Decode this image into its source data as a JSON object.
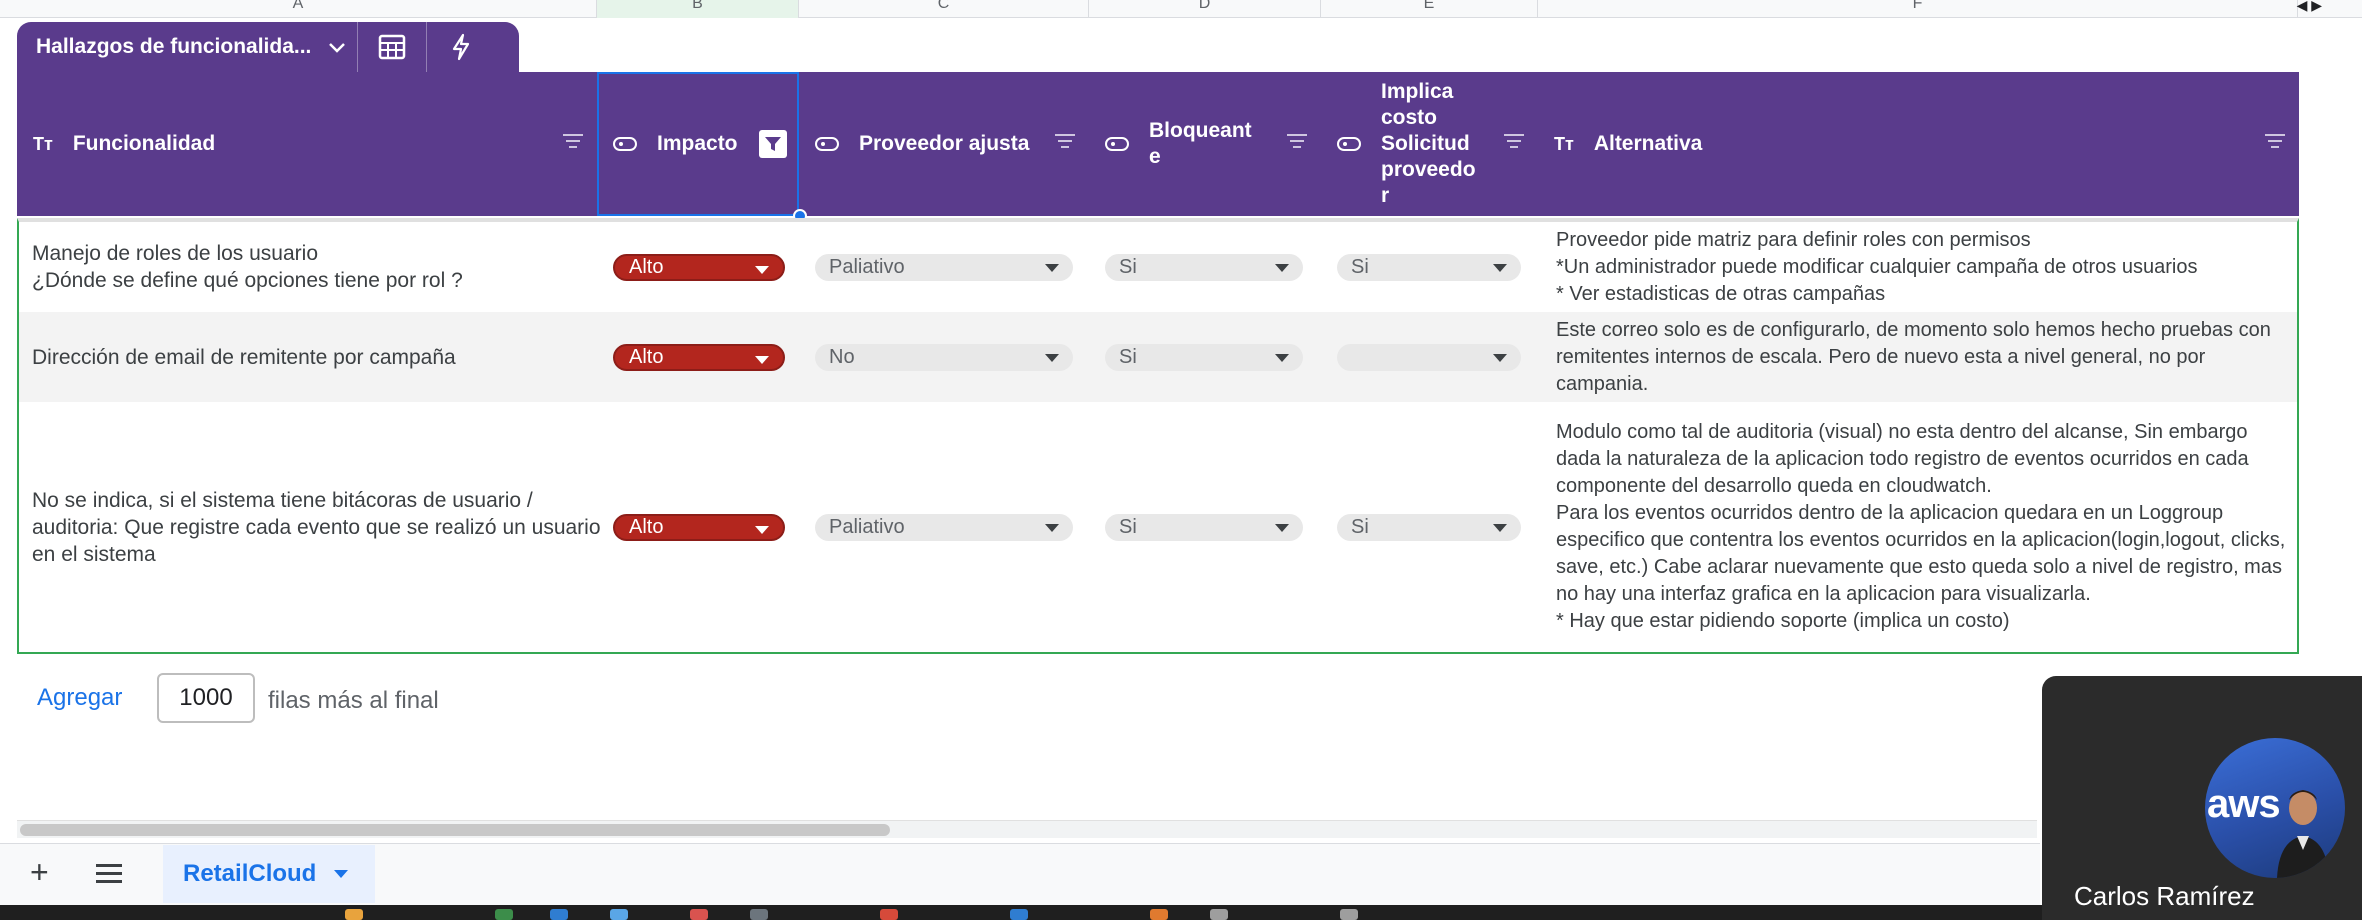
{
  "column_letters": [
    "A",
    "B",
    "C",
    "D",
    "E",
    "F"
  ],
  "table_tab": {
    "name": "Hallazgos de funcionalida..."
  },
  "headers": {
    "funcionalidad": "Funcionalidad",
    "impacto": "Impacto",
    "proveedor": "Proveedor ajusta",
    "bloqueante": "Bloqueant e",
    "implica": "Implica costo Solicitud proveedo r",
    "alternativa": "Alternativa",
    "text_icon": "Tт"
  },
  "rows": [
    {
      "funcionalidad": "Manejo de roles de los usuario\n¿Dónde se define qué opciones tiene por rol ?",
      "impacto": "Alto",
      "proveedor": "Paliativo",
      "bloqueante": "Si",
      "implica": "Si",
      "alternativa": "Proveedor pide matriz para definir roles con permisos\n*Un administrador puede modificar cualquier campaña de otros usuarios\n* Ver estadisticas de otras campañas"
    },
    {
      "funcionalidad": "Dirección de email de remitente por campaña",
      "impacto": "Alto",
      "proveedor": "No",
      "bloqueante": "Si",
      "implica": "",
      "alternativa": "Este correo solo es de configurarlo, de momento solo hemos hecho pruebas con remitentes internos de escala. Pero de nuevo esta a nivel general, no por campania."
    },
    {
      "funcionalidad": "No se indica, si el sistema tiene bitácoras de usuario / auditoria: Que registre cada evento que se realizó un usuario en el sistema",
      "impacto": "Alto",
      "proveedor": "Paliativo",
      "bloqueante": "Si",
      "implica": "Si",
      "alternativa": "Modulo como tal de auditoria (visual) no esta dentro del alcanse, Sin embargo dada la naturaleza de la aplicacion todo registro de eventos ocurridos en cada componente del desarrollo queda en cloudwatch.\nPara los eventos ocurridos dentro de la aplicacion quedara en un Loggroup especifico que contentra los eventos ocurridos en la aplicacion(login,logout, clicks, save, etc.) Cabe aclarar nuevamente que esto queda solo a nivel de registro, mas no hay una interfaz grafica en la aplicacion para visualizarla.\n* Hay que estar pidiendo soporte (implica un costo)"
    }
  ],
  "footer": {
    "add_label": "Agregar",
    "rows_value": "1000",
    "rows_suffix": "filas más al final"
  },
  "sheet_tab": {
    "name": "RetailCloud",
    "add_symbol": "+"
  },
  "video": {
    "participant_name": "Carlos Ramírez",
    "avatar_text": "aws"
  },
  "colors": {
    "header_bg": "#5a3b8c",
    "chip_alto": "#b3261e",
    "accent_blue": "#1a73e8"
  }
}
